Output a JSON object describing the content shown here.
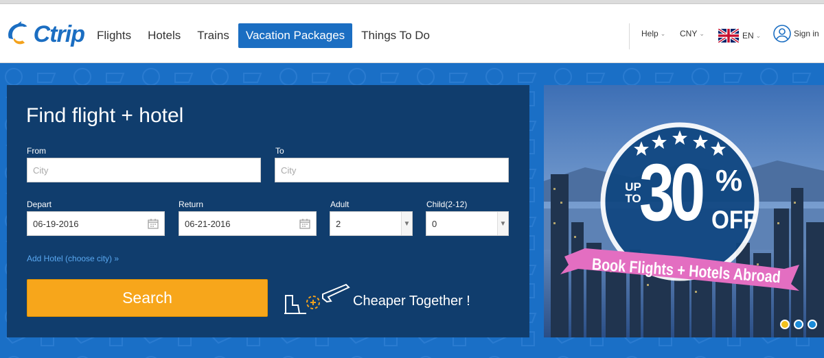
{
  "header": {
    "logo_text": "Ctrip",
    "nav": [
      {
        "label": "Flights",
        "active": false
      },
      {
        "label": "Hotels",
        "active": false
      },
      {
        "label": "Trains",
        "active": false
      },
      {
        "label": "Vacation Packages",
        "active": true
      },
      {
        "label": "Things To Do",
        "active": false
      }
    ],
    "help": "Help",
    "currency": "CNY",
    "language": "EN",
    "sign_in": "Sign in"
  },
  "search_panel": {
    "title": "Find flight + hotel",
    "from": {
      "label": "From",
      "placeholder": "City",
      "value": ""
    },
    "to": {
      "label": "To",
      "placeholder": "City",
      "value": ""
    },
    "depart": {
      "label": "Depart",
      "value": "06-19-2016"
    },
    "return": {
      "label": "Return",
      "value": "06-21-2016"
    },
    "adult": {
      "label": "Adult",
      "value": "2"
    },
    "child": {
      "label": "Child(2-12)",
      "value": "0"
    },
    "add_hotel": "Add Hotel (choose city)",
    "search_button": "Search",
    "cheaper_text": "Cheaper Together !"
  },
  "banner": {
    "up_to": "UP TO",
    "number": "30",
    "percent": "%",
    "off": "OFF",
    "ribbon": "Book Flights + Hotels Abroad",
    "dots": [
      {
        "color": "#f3c11c",
        "active": true
      },
      {
        "color": "#1b8bd8",
        "active": false
      },
      {
        "color": "#1b8bd8",
        "active": false
      }
    ]
  },
  "colors": {
    "brand_blue": "#1b6ec2",
    "panel_navy": "#103d6d",
    "search_orange": "#f7a61b",
    "ribbon_pink": "#e36ec1"
  }
}
